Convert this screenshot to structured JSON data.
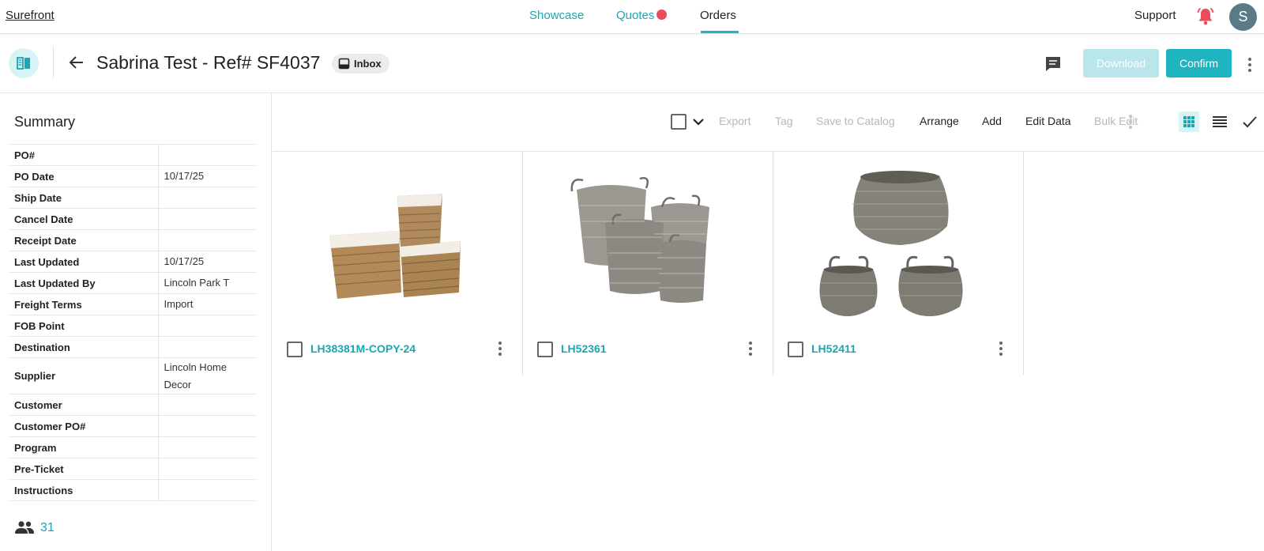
{
  "topnav": {
    "brand": "Surefront",
    "tabs": [
      {
        "label": "Showcase"
      },
      {
        "label": "Quotes"
      },
      {
        "label": "Orders"
      }
    ],
    "support": "Support",
    "avatar_initial": "S",
    "icons": {
      "bell": "bell-icon",
      "quotes_indicator": "red-dot"
    },
    "colors": {
      "accent": "#1fb4bf",
      "alert": "#ea4d5a"
    }
  },
  "header": {
    "title": "Sabrina Test - Ref# SF4037",
    "status_chip": "Inbox",
    "download_label": "Download",
    "confirm_label": "Confirm"
  },
  "summary": {
    "title": "Summary",
    "rows": [
      {
        "label": "PO#",
        "value": ""
      },
      {
        "label": "PO Date",
        "value": "10/17/25"
      },
      {
        "label": "Ship Date",
        "value": ""
      },
      {
        "label": "Cancel Date",
        "value": ""
      },
      {
        "label": "Receipt Date",
        "value": ""
      },
      {
        "label": "Last Updated",
        "value": "10/17/25"
      },
      {
        "label": "Last Updated By",
        "value": "Lincoln Park T"
      },
      {
        "label": "Freight Terms",
        "value": "Import"
      },
      {
        "label": "FOB Point",
        "value": ""
      },
      {
        "label": "Destination",
        "value": ""
      },
      {
        "label": "Supplier",
        "value": "Lincoln Home Decor"
      },
      {
        "label": "Customer",
        "value": ""
      },
      {
        "label": "Customer PO#",
        "value": ""
      },
      {
        "label": "Program",
        "value": ""
      },
      {
        "label": "Pre-Ticket",
        "value": ""
      },
      {
        "label": "Instructions",
        "value": ""
      }
    ],
    "user_count": "31"
  },
  "toolbar": {
    "export": "Export",
    "tag": "Tag",
    "save_to_catalog": "Save to Catalog",
    "arrange": "Arrange",
    "add": "Add",
    "edit_data": "Edit Data",
    "bulk_edit": "Bulk Edit",
    "view_mode": "grid"
  },
  "products": [
    {
      "sku": "LH38381M-COPY-24",
      "image": "seagrass-storage-baskets"
    },
    {
      "sku": "LH52361",
      "image": "grey-wicker-round-baskets"
    },
    {
      "sku": "LH52411",
      "image": "grey-wicker-bellied-baskets"
    }
  ]
}
